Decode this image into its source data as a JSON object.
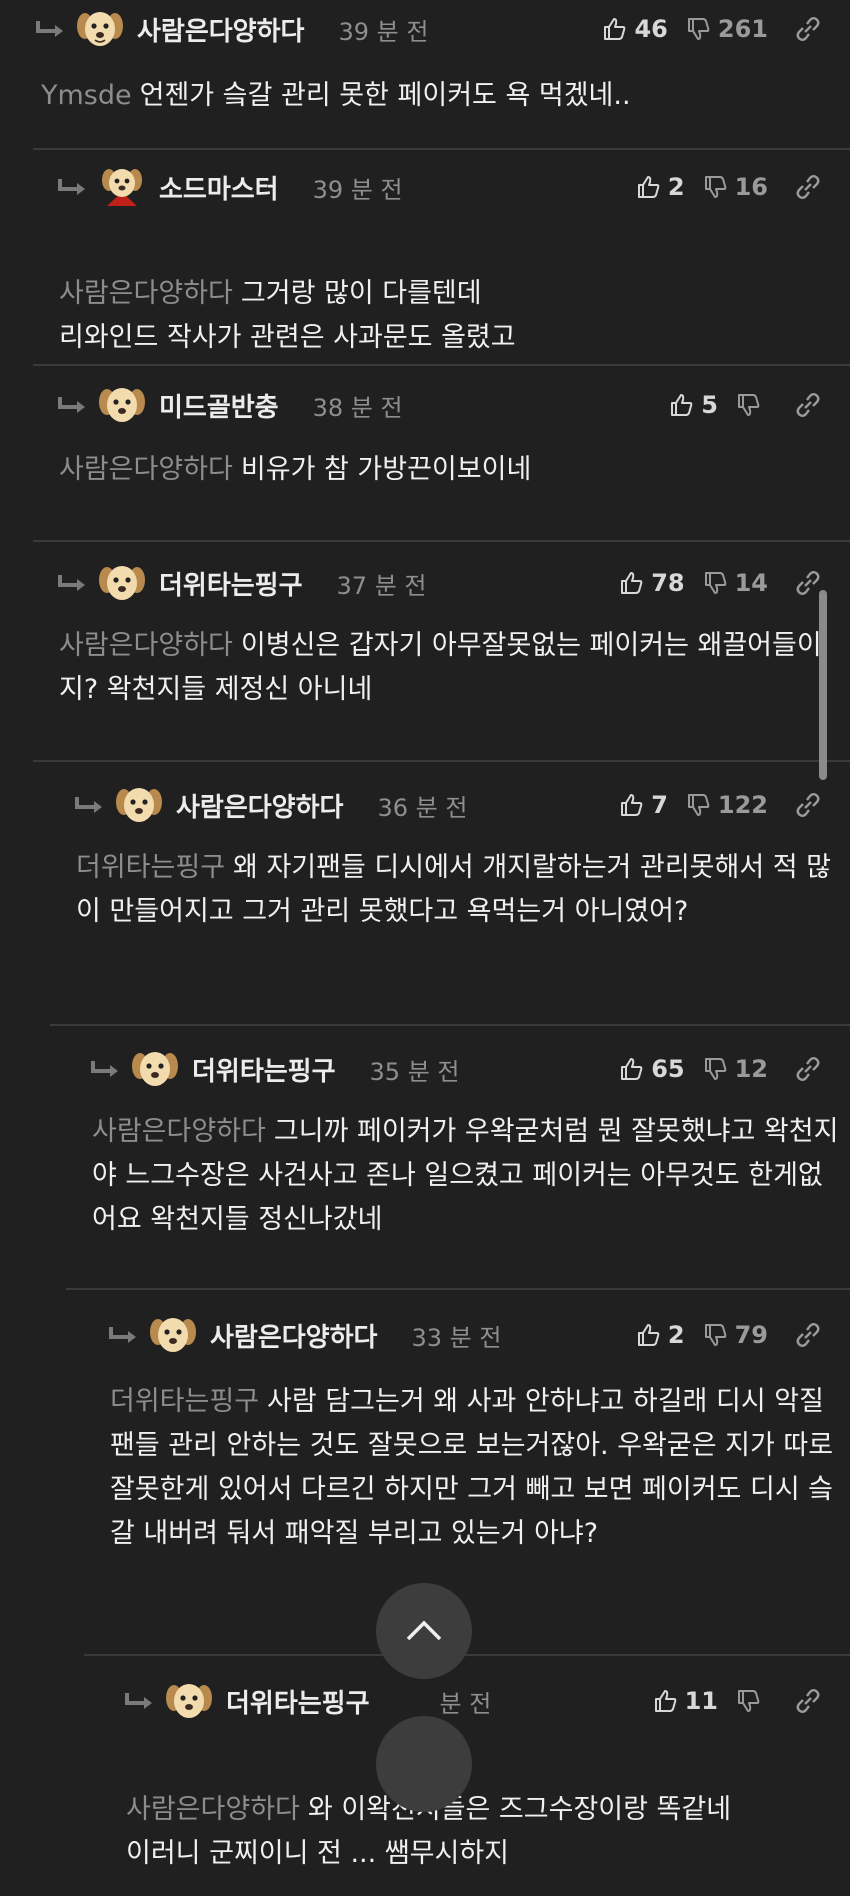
{
  "comments": [
    {
      "nick": "사람은다양하다",
      "time": "39 분 전",
      "likes": "46",
      "dislikes": "261",
      "mention": "Ymsde",
      "text": "언젠가 슼갈 관리 못한 페이커도 욕 먹겠네..",
      "avatar": "puppy-icon"
    },
    {
      "nick": "소드마스터",
      "time": "39 분 전",
      "likes": "2",
      "dislikes": "16",
      "mention": "사람은다양하다",
      "text": "그거랑 많이 다를텐데\n리와인드 작사가 관련은 사과문도 올렸고",
      "avatar": "puppy-cape-icon"
    },
    {
      "nick": "미드골반충",
      "time": "38 분 전",
      "likes": "5",
      "dislikes": "",
      "mention": "사람은다양하다",
      "text": "비유가 참 가방끈이보이네",
      "avatar": "puppy-icon"
    },
    {
      "nick": "더위타는핑구",
      "time": "37 분 전",
      "likes": "78",
      "dislikes": "14",
      "mention": "사람은다양하다",
      "text": "이병신은 갑자기 아무잘못없는 페이커는 왜끌어들이지? 왁천지들 제정신 아니네",
      "avatar": "puppy-icon"
    },
    {
      "nick": "사람은다양하다",
      "time": "36 분 전",
      "likes": "7",
      "dislikes": "122",
      "mention": "더위타는핑구",
      "text": "왜 자기팬들 디시에서 개지랄하는거 관리못해서 적 많이 만들어지고 그거 관리 못했다고 욕먹는거 아니였어?",
      "avatar": "puppy-icon"
    },
    {
      "nick": "더위타는핑구",
      "time": "35 분 전",
      "likes": "65",
      "dislikes": "12",
      "mention": "사람은다양하다",
      "text": "그니까 페이커가 우왁굳처럼 뭔 잘못했냐고 왁천지야 느그수장은 사건사고 존나 일으켰고 페이커는 아무것도 한게없어요 왁천지들 정신나갔네",
      "avatar": "puppy-icon"
    },
    {
      "nick": "사람은다양하다",
      "time": "33 분 전",
      "likes": "2",
      "dislikes": "79",
      "mention": "더위타는핑구",
      "text": "사람 담그는거 왜 사과 안하냐고 하길래 디시 악질 팬들 관리 안하는 것도 잘못으로 보는거잖아. 우왁굳은 지가 따로 잘못한게 있어서 다르긴 하지만 그거 빼고 보면 페이커도 디시 슼갈 내버려 둬서 패악질 부리고 있는거 아냐?",
      "avatar": "puppy-icon"
    },
    {
      "nick": "더위타는핑구",
      "time": "분 전",
      "likes": "11",
      "dislikes": "",
      "mention": "사람은다양하다",
      "text": "와 이왁천지들은 즈그수장이랑 똑같네\n이러니 군찌이니 전  ... 쌤무시하지",
      "avatar": "puppy-icon"
    }
  ],
  "scroll_top_icon": "chevron-up-icon",
  "colors": {
    "bg": "#202020",
    "text": "#f0f0f0",
    "mention": "#8d8d8d",
    "divider": "#3a3a3a"
  }
}
